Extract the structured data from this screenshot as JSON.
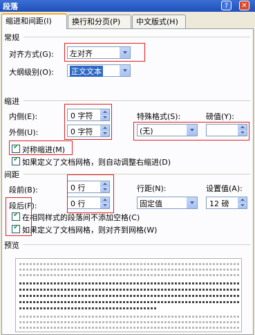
{
  "window": {
    "title": "段落",
    "help_label": "?",
    "close_label": "✕"
  },
  "tabs": [
    {
      "label": "缩进和间距(I)"
    },
    {
      "label": "换行和分页(P)"
    },
    {
      "label": "中文版式(H)"
    }
  ],
  "general": {
    "section_label": "常规",
    "alignment_label": "对齐方式(G):",
    "alignment_value": "左对齐",
    "outline_label": "大纲级别(O):",
    "outline_value": "正文文本"
  },
  "indent": {
    "section_label": "缩进",
    "inside_label": "内侧(E):",
    "inside_value": "0 字符",
    "outside_label": "外侧(U):",
    "outside_value": "0 字符",
    "special_label": "特殊格式(S):",
    "special_value": "(无)",
    "by_label": "磅值(Y):",
    "by_value": "",
    "mirror_label": "对称缩进(M)",
    "mirror_checked": true,
    "auto_right_label": "如果定义了文档网格，则自动调整右缩进(D)",
    "auto_right_checked": true
  },
  "spacing": {
    "section_label": "间距",
    "before_label": "段前(B):",
    "before_value": "0 行",
    "after_label": "段后(F):",
    "after_value": "0 行",
    "line_label": "行距(N):",
    "line_value": "固定值",
    "at_label": "设置值(A):",
    "at_value": "12 磅",
    "no_space_label": "在相同样式的段落间不添加空格(C)",
    "no_space_checked": true,
    "snap_grid_label": "如果定义了文档网格，则对齐到网格(W)",
    "snap_grid_checked": true
  },
  "preview": {
    "section_label": "预览"
  }
}
